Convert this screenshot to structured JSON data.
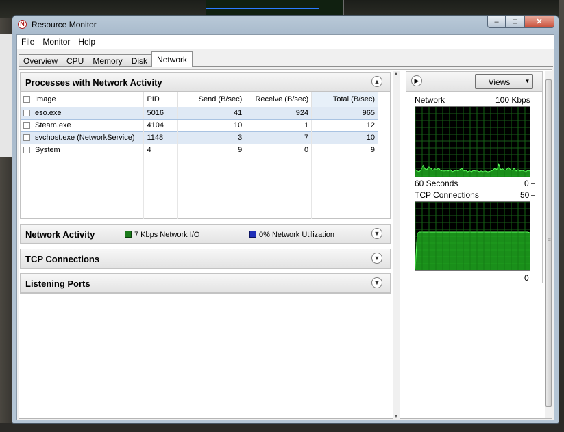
{
  "window": {
    "title": "Resource Monitor",
    "controls": {
      "minimize": "–",
      "maximize": "□",
      "close": "✕"
    }
  },
  "menu": [
    "File",
    "Monitor",
    "Help"
  ],
  "tabs": [
    "Overview",
    "CPU",
    "Memory",
    "Disk",
    "Network"
  ],
  "active_tab": "Network",
  "processes": {
    "title": "Processes with Network Activity",
    "columns": [
      "Image",
      "PID",
      "Send (B/sec)",
      "Receive (B/sec)",
      "Total (B/sec)"
    ],
    "rows": [
      {
        "image": "eso.exe",
        "pid": "5016",
        "send": "41",
        "receive": "924",
        "total": "965"
      },
      {
        "image": "Steam.exe",
        "pid": "4104",
        "send": "10",
        "receive": "1",
        "total": "12"
      },
      {
        "image": "svchost.exe (NetworkService)",
        "pid": "1148",
        "send": "3",
        "receive": "7",
        "total": "10"
      },
      {
        "image": "System",
        "pid": "4",
        "send": "9",
        "receive": "0",
        "total": "9"
      }
    ]
  },
  "network_activity": {
    "title": "Network Activity",
    "io_text": "7 Kbps Network I/O",
    "util_text": "0% Network Utilization",
    "io_color": "#1a7a1a",
    "util_color": "#1f2fb8"
  },
  "tcp_section": {
    "title": "TCP Connections"
  },
  "listening_section": {
    "title": "Listening Ports"
  },
  "side": {
    "views_label": "Views",
    "graph1": {
      "name": "Network",
      "max": "100 Kbps",
      "time": "60 Seconds",
      "min": "0",
      "values": [
        0.1,
        0.08,
        0.07,
        0.1,
        0.16,
        0.11,
        0.1,
        0.14,
        0.12,
        0.09,
        0.11,
        0.1,
        0.12,
        0.09,
        0.08,
        0.08,
        0.09,
        0.08,
        0.1,
        0.07,
        0.08,
        0.09,
        0.08,
        0.1,
        0.12,
        0.08,
        0.09,
        0.07,
        0.08,
        0.07,
        0.09,
        0.08,
        0.08,
        0.07,
        0.08,
        0.07,
        0.08,
        0.07,
        0.07,
        0.08,
        0.09,
        0.12,
        0.1,
        0.18,
        0.1,
        0.11,
        0.09,
        0.1,
        0.13,
        0.1,
        0.09,
        0.12,
        0.08,
        0.1,
        0.08,
        0.09,
        0.08,
        0.07,
        0.09,
        0.08
      ]
    },
    "graph2": {
      "name": "TCP Connections",
      "max": "50",
      "min": "0",
      "values": [
        0.02,
        0.54,
        0.56,
        0.56,
        0.56,
        0.56,
        0.56,
        0.56,
        0.56,
        0.56,
        0.56,
        0.56,
        0.56,
        0.56,
        0.56,
        0.56,
        0.56,
        0.56,
        0.56,
        0.56,
        0.56,
        0.56,
        0.56,
        0.56,
        0.56,
        0.56,
        0.56,
        0.56,
        0.56,
        0.56,
        0.56,
        0.56,
        0.56,
        0.56,
        0.56,
        0.56,
        0.56,
        0.56,
        0.56,
        0.56,
        0.56,
        0.56,
        0.56,
        0.56,
        0.56,
        0.56,
        0.56,
        0.56,
        0.56,
        0.56,
        0.56,
        0.56,
        0.56,
        0.56,
        0.56,
        0.56,
        0.56,
        0.56,
        0.56,
        0.55
      ]
    }
  }
}
